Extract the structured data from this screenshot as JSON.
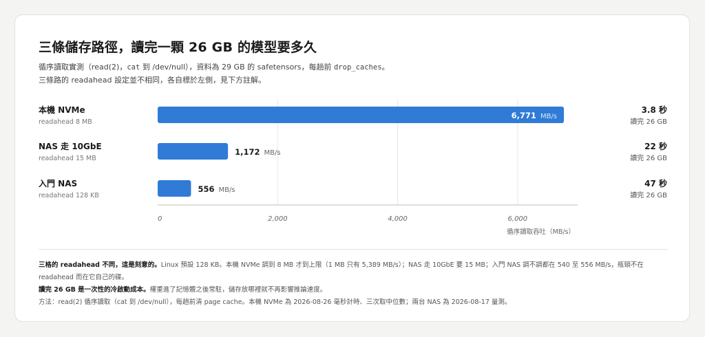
{
  "title": "三條儲存路徑，讀完一顆 26 GB 的模型要多久",
  "subtitle": {
    "line1_pre": "循序讀取實測（read(2)，",
    "line1_code1": "cat",
    "line1_mid": " 到 /dev/null），資料為 29 GB 的 safetensors，每趟前 ",
    "line1_code2": "drop_caches",
    "line1_post": "。",
    "line2": "三條路的 readahead 設定並不相同，各自標於左側，見下方註解。"
  },
  "chart_data": {
    "type": "bar",
    "orientation": "horizontal",
    "categories": [
      "本機 NVMe",
      "NAS 走 10GbE",
      "入門 NAS"
    ],
    "sublabels": [
      "readahead 8 MB",
      "readahead 15 MB",
      "readahead 128 KB"
    ],
    "values": [
      6771,
      1172,
      556
    ],
    "value_labels": [
      "6,771",
      "1,172",
      "556"
    ],
    "unit": "MB/s",
    "right_main": [
      "3.8 秒",
      "22 秒",
      "47 秒"
    ],
    "right_sub": [
      "讀完 26 GB",
      "讀完 26 GB",
      "讀完 26 GB"
    ],
    "xlim": [
      0,
      7000
    ],
    "ticks": [
      0,
      2000,
      4000,
      6000
    ],
    "tick_labels": [
      "0",
      "2,000",
      "4,000",
      "6,000"
    ],
    "xlabel": "循序讀取吞吐（MB/s）",
    "grid": true,
    "colors": {
      "bar": "#2f7bd6",
      "grid": "#e6e6e3",
      "axis": "#bdbdb8"
    }
  },
  "notes": {
    "n1_bold": "三格的 readahead 不同，這是刻意的。",
    "n1_text": "Linux 預設 128 KB。本機 NVMe 調到 8 MB 才到上限（1 MB 只有 5,389 MB/s）；NAS 走 10GbE 要 15 MB；入門 NAS 調不調都在 540 至 556 MB/s，瓶頸不在",
    "n1_cont": "readahead 而在它自己的碟。",
    "n2_bold": "讀完 26 GB 是一次性的冷啟動成本。",
    "n2_text": "權重進了記憶體之後常駐，儲存放哪裡就不再影響推論速度。",
    "n3": "方法：read(2) 循序讀取（cat 到 /dev/null），每趟前清 page cache。本機 NVMe 為 2026-08-26 毫秒計時、三次取中位數；兩台 NAS 為 2026-08-17 量測。"
  }
}
